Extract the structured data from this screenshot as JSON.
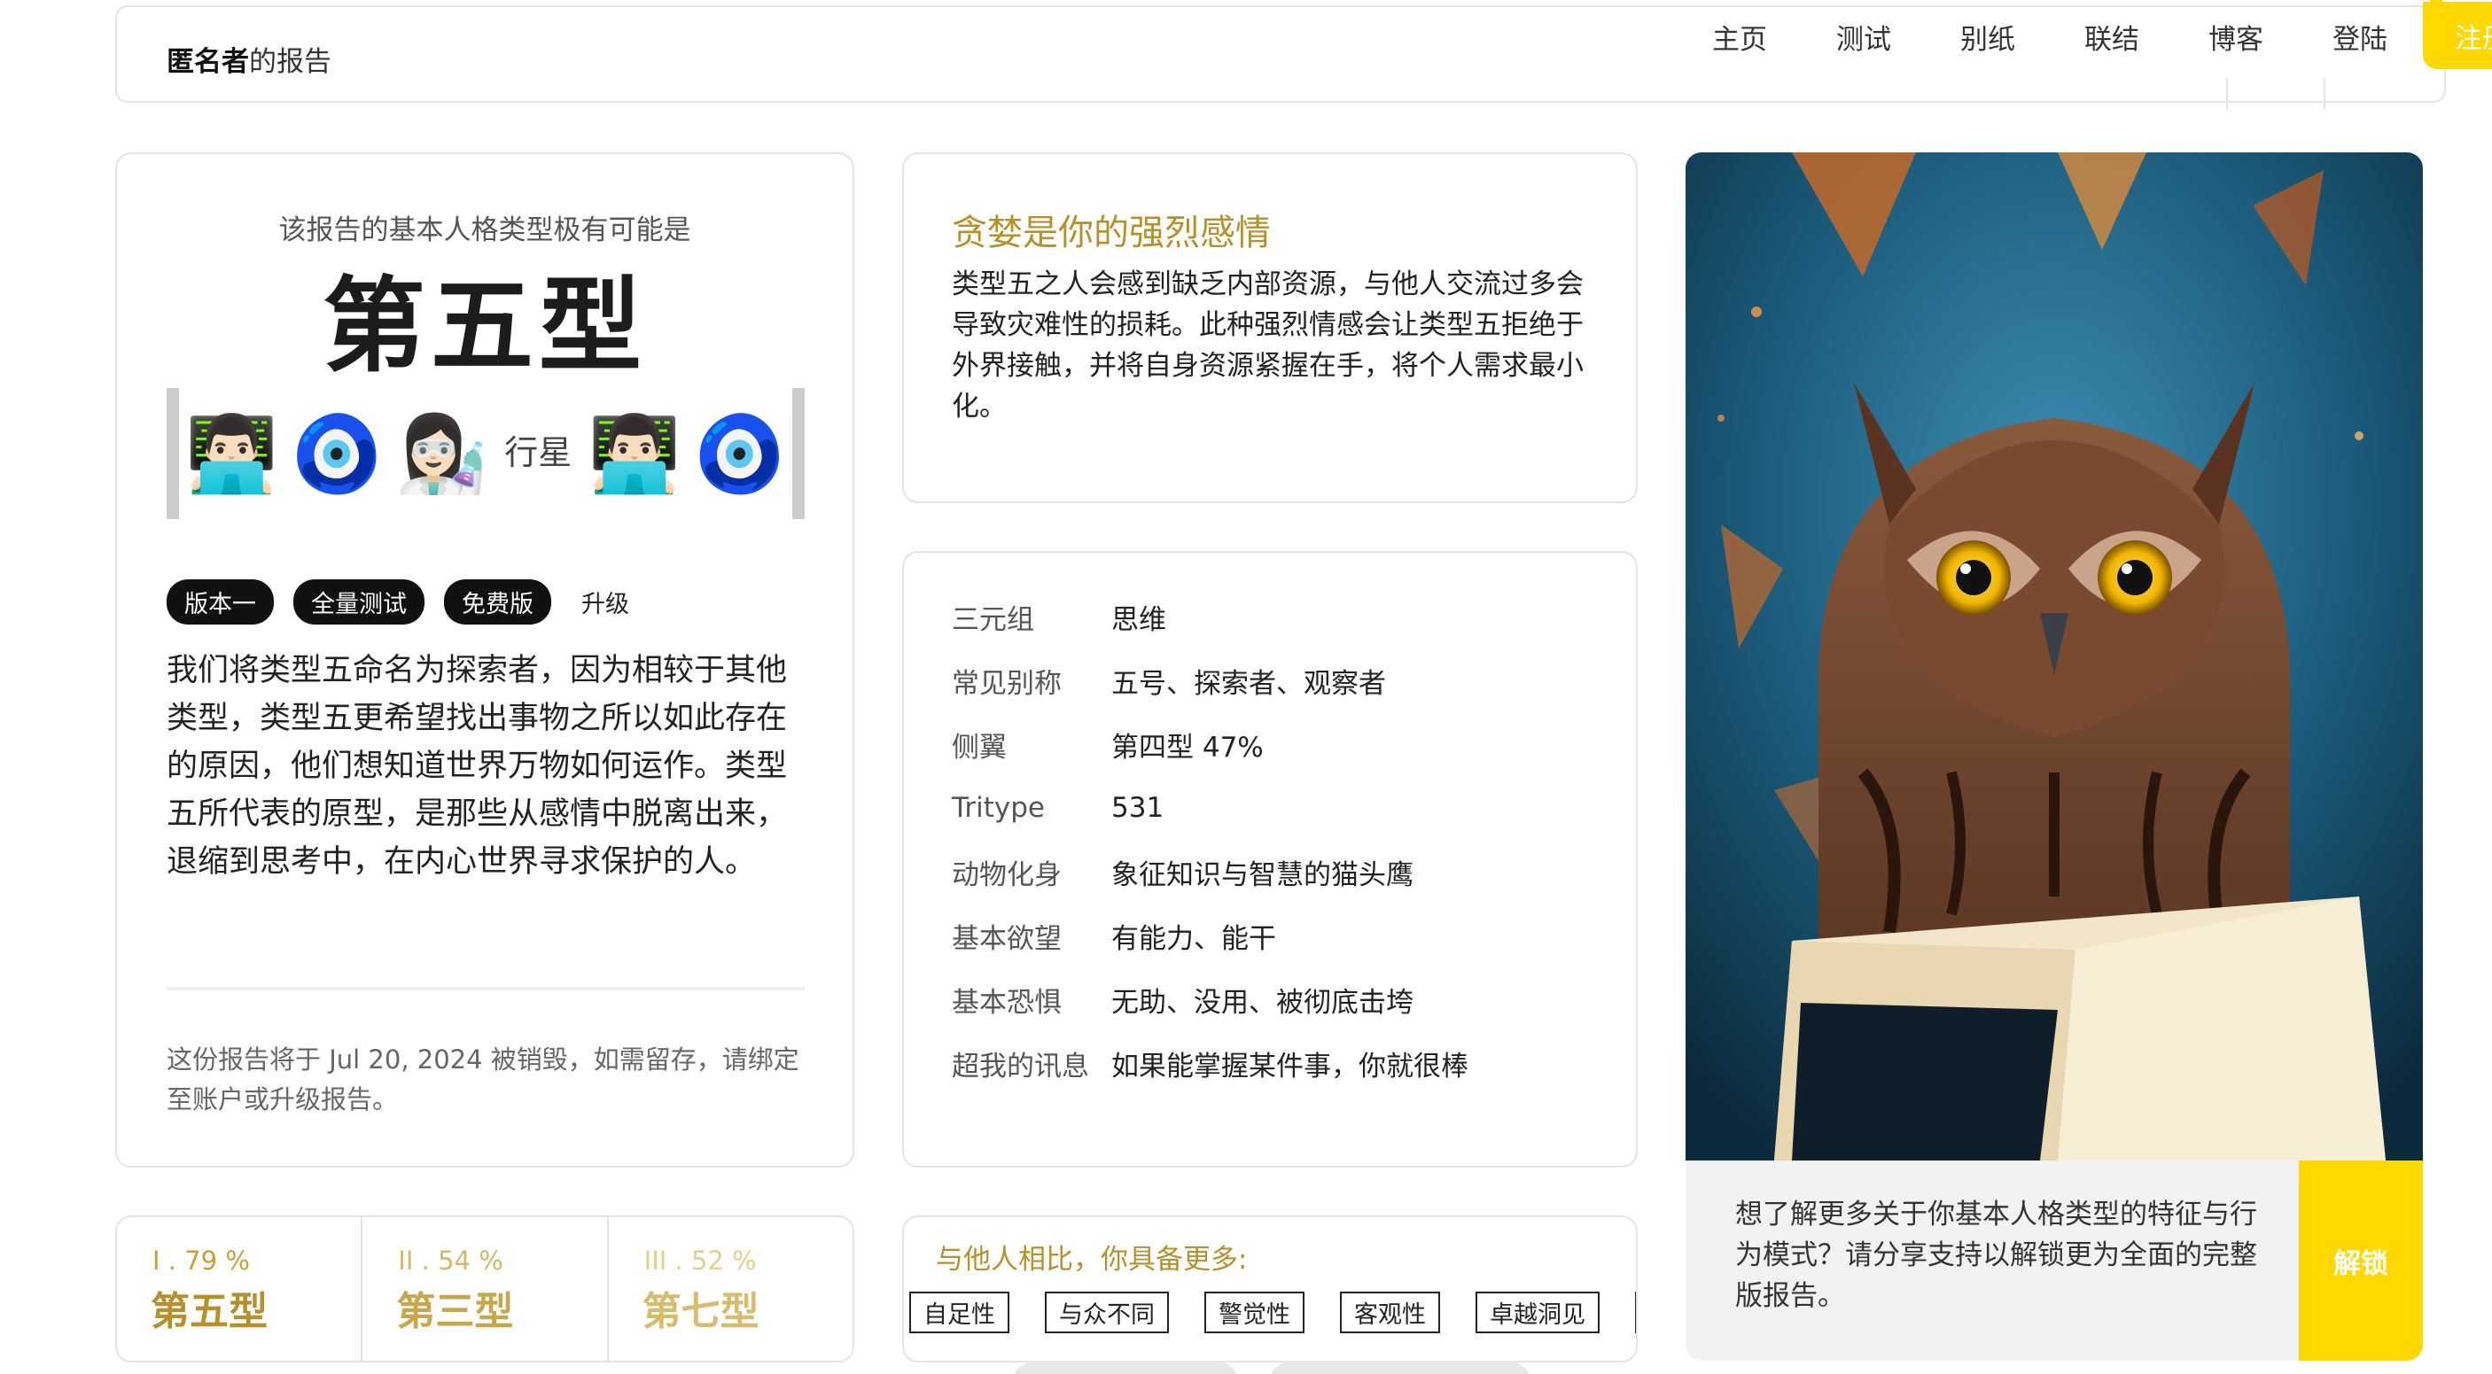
{
  "header": {
    "brand_strong": "匿名者",
    "brand_rest": "的报告",
    "nav": [
      "主页",
      "测试",
      "别纸",
      "联结",
      "博客",
      "登陆"
    ],
    "register": "注册"
  },
  "type_card": {
    "subtitle": "该报告的基本人格类型极有可能是",
    "main_type": "第五型",
    "emojis": [
      "👨🏻‍💻",
      "🧿",
      "👩🏻‍🔬",
      "行星",
      "👨🏻‍💻",
      "🧿"
    ],
    "tags": [
      "版本一",
      "全量测试",
      "免费版"
    ],
    "upgrade": "升级",
    "description": "我们将类型五命名为探索者，因为相较于其他类型，类型五更希望找出事物之所以如此存在的原因，他们想知道世界万物如何运作。类型五所代表的原型，是那些从感情中脱离出来，退缩到思考中，在内心世界寻求保护的人。",
    "note": "这份报告将于 Jul 20, 2024 被销毁，如需留存，请绑定至账户或升级报告。"
  },
  "passion": {
    "title": "贪婪是你的强烈感情",
    "text": "类型五之人会感到缺乏内部资源，与他人交流过多会导致灾难性的损耗。此种强烈情感会让类型五拒绝于外界接触，并将自身资源紧握在手，将个人需求最小化。"
  },
  "info": [
    {
      "label": "三元组",
      "value": "思维"
    },
    {
      "label": "常见别称",
      "value": "五号、探索者、观察者"
    },
    {
      "label": "侧翼",
      "value": "第四型 47%"
    },
    {
      "label": "Tritype",
      "value": "531"
    },
    {
      "label": "动物化身",
      "value": "象征知识与智慧的猫头鹰"
    },
    {
      "label": "基本欲望",
      "value": "有能力、能干"
    },
    {
      "label": "基本恐惧",
      "value": "无助、没用、被彻底击垮"
    },
    {
      "label": "超我的讯息",
      "value": "如果能掌握某件事，你就很棒"
    }
  ],
  "owl_card": {
    "caption": "想了解更多关于你基本人格类型的特征与行为模式？请分享支持以解锁更为全面的完整版报告。",
    "unlock": "解锁"
  },
  "top3": [
    {
      "rank": "I",
      "pct": "79",
      "name": "第五型"
    },
    {
      "rank": "II",
      "pct": "54",
      "name": "第三型"
    },
    {
      "rank": "III",
      "pct": "52",
      "name": "第七型"
    }
  ],
  "traits": {
    "title": "与他人相比，你具备更多:",
    "items": [
      "自足性",
      "与众不同",
      "警觉性",
      "客观性",
      "卓越洞见"
    ]
  }
}
